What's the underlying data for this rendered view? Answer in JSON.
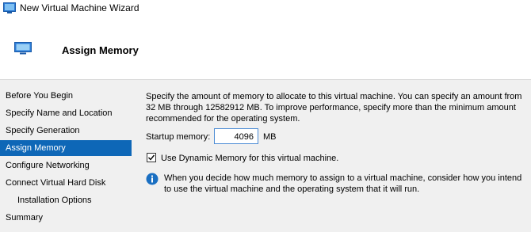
{
  "window": {
    "title": "New Virtual Machine Wizard"
  },
  "header": {
    "title": "Assign Memory"
  },
  "sidebar": {
    "items": [
      {
        "label": "Before You Begin"
      },
      {
        "label": "Specify Name and Location"
      },
      {
        "label": "Specify Generation"
      },
      {
        "label": "Assign Memory"
      },
      {
        "label": "Configure Networking"
      },
      {
        "label": "Connect Virtual Hard Disk"
      },
      {
        "label": "Installation Options"
      },
      {
        "label": "Summary"
      }
    ],
    "selected": "Assign Memory"
  },
  "main": {
    "description": "Specify the amount of memory to allocate to this virtual machine. You can specify an amount from 32 MB through 12582912 MB. To improve performance, specify more than the minimum amount recommended for the operating system.",
    "startup_memory": {
      "label": "Startup memory:",
      "value": "4096",
      "unit": "MB"
    },
    "dynamic_memory": {
      "label": "Use Dynamic Memory for this virtual machine.",
      "checked": true
    },
    "info": "When you decide how much memory to assign to a virtual machine, consider how you intend to use the virtual machine and the operating system that it will run."
  },
  "icons": {
    "app": "virtual-machine-icon",
    "info": "info-icon"
  },
  "colors": {
    "selection": "#0e67b7",
    "panel_background": "#f0f0f0",
    "info_icon": "#1a6fc2"
  }
}
